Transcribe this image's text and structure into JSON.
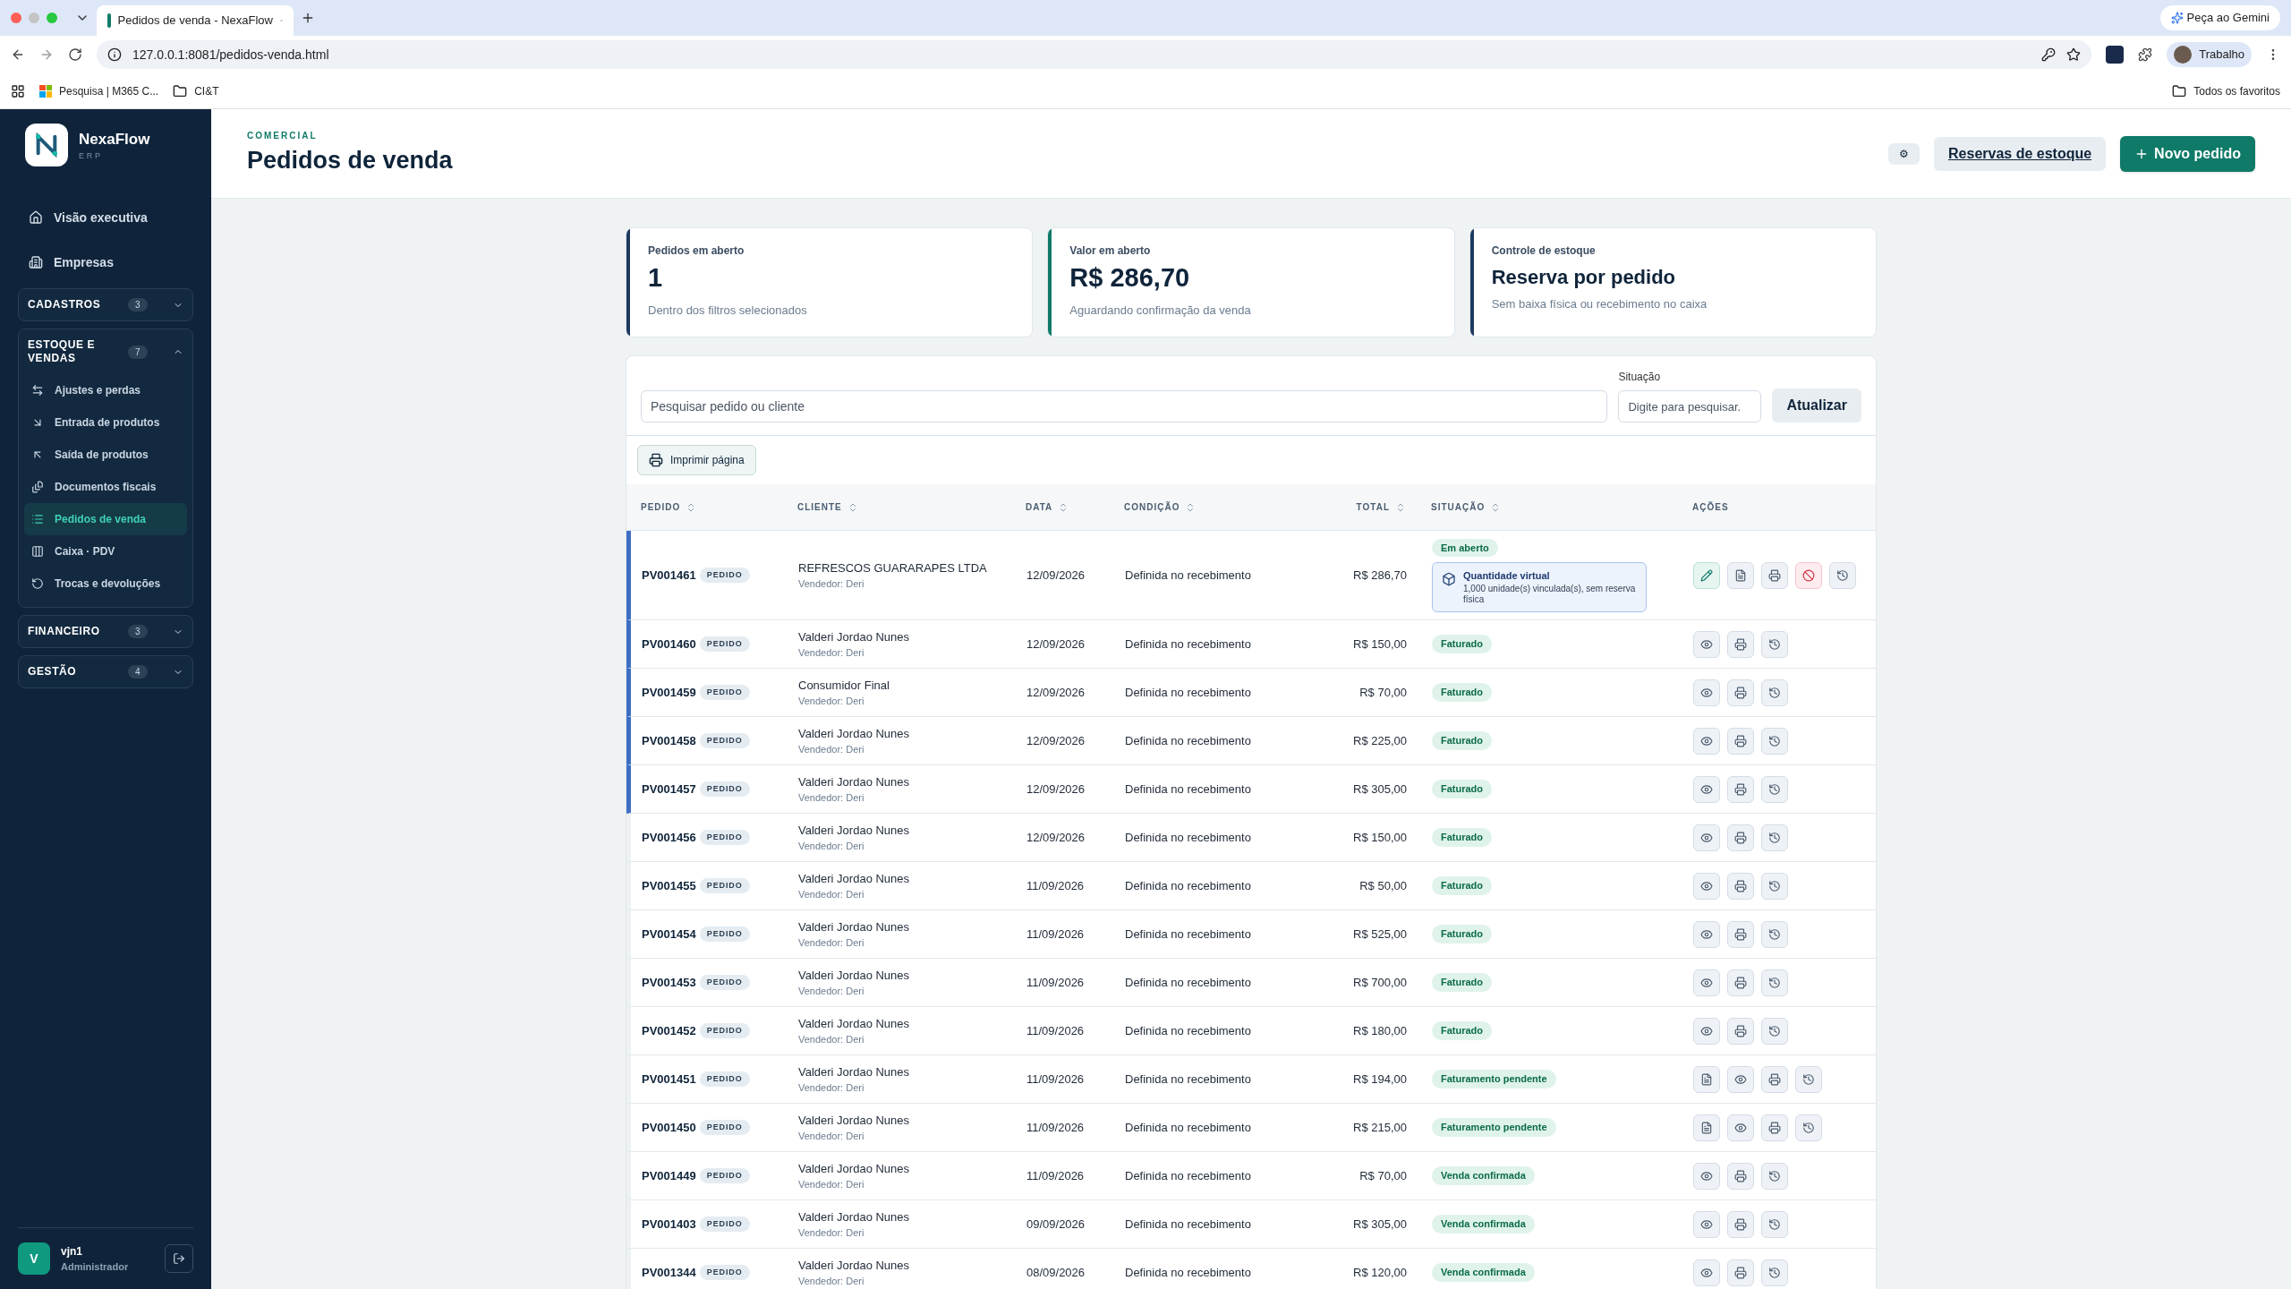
{
  "browser": {
    "tab_title": "Pedidos de venda - NexaFlow",
    "gemini": "Peça ao Gemini",
    "url": "127.0.0.1:8081/pedidos-venda.html",
    "profile": "Trabalho",
    "bookmarks": [
      "Pesquisa | M365 C...",
      "CI&T"
    ],
    "all_bookmarks": "Todos os favoritos"
  },
  "brand": {
    "name": "NexaFlow",
    "subtitle": "ERP"
  },
  "sidebar": {
    "links": [
      {
        "label": "Visão executiva",
        "selected": false
      },
      {
        "label": "Empresas",
        "selected": false
      }
    ],
    "groups": [
      {
        "label": "CADASTROS",
        "count": "3",
        "expanded": false
      },
      {
        "label": "ESTOQUE E VENDAS",
        "count": "7",
        "expanded": true,
        "items": [
          {
            "label": "Ajustes e perdas",
            "selected": false
          },
          {
            "label": "Entrada de produtos",
            "selected": false
          },
          {
            "label": "Saída de produtos",
            "selected": false
          },
          {
            "label": "Documentos fiscais",
            "selected": false
          },
          {
            "label": "Pedidos de venda",
            "selected": true
          },
          {
            "label": "Caixa · PDV",
            "selected": false
          },
          {
            "label": "Trocas e devoluções",
            "selected": false
          }
        ]
      },
      {
        "label": "FINANCEIRO",
        "count": "3",
        "expanded": false
      },
      {
        "label": "GESTÃO",
        "count": "4",
        "expanded": false
      }
    ],
    "user": {
      "initial": "V",
      "name": "vjn1",
      "role": "Administrador"
    }
  },
  "header": {
    "eyebrow": "COMERCIAL",
    "title": "Pedidos de venda",
    "settings_glyph": "⚙",
    "reservations": "Reservas de estoque",
    "new_order": "Novo pedido"
  },
  "cards": [
    {
      "label": "Pedidos em aberto",
      "value": "1",
      "note": "Dentro dos filtros selecionados",
      "color": "#1e3a5f"
    },
    {
      "label": "Valor em aberto",
      "value": "R$ 286,70",
      "note": "Aguardando confirmação da venda",
      "color": "#0f7a68"
    },
    {
      "label": "Controle de estoque",
      "value": "Reserva por pedido",
      "note": "Sem baixa física ou recebimento no caixa",
      "color": "#1e3a5f"
    }
  ],
  "filters": {
    "search_placeholder": "Pesquisar pedido ou cliente",
    "status_label": "Situação",
    "status_placeholder": "Digite para pesquisar.",
    "refresh": "Atualizar",
    "print": "Imprimir página"
  },
  "table": {
    "columns": [
      {
        "label": "PEDIDO",
        "sortable": true
      },
      {
        "label": "CLIENTE",
        "sortable": true
      },
      {
        "label": "DATA",
        "sortable": true
      },
      {
        "label": "CONDIÇÃO",
        "sortable": true
      },
      {
        "label": "TOTAL",
        "sortable": true
      },
      {
        "label": "SITUAÇÃO",
        "sortable": true
      },
      {
        "label": "AÇÕES",
        "sortable": false
      }
    ],
    "rows": [
      {
        "id": "PV001461",
        "tag": "PEDIDO",
        "client": "REFRESCOS GUARARAPES LTDA",
        "seller": "Vendedor: Deri",
        "date": "12/09/2026",
        "condition": "Definida no recebimento",
        "total": "R$ 286,70",
        "status": "Em aberto",
        "flagged": true,
        "note": {
          "title": "Quantidade virtual",
          "text": "1,000 unidade(s) vinculada(s), sem reserva física"
        },
        "actions": [
          {
            "kind": "edit"
          },
          {
            "kind": "document"
          },
          {
            "kind": "print"
          },
          {
            "kind": "cancel"
          },
          {
            "kind": "history"
          }
        ]
      },
      {
        "id": "PV001460",
        "tag": "PEDIDO",
        "client": "Valderi Jordao Nunes",
        "seller": "Vendedor: Deri",
        "date": "12/09/2026",
        "condition": "Definida no recebimento",
        "total": "R$ 150,00",
        "status": "Faturado",
        "flagged": true,
        "actions": [
          {
            "kind": "view"
          },
          {
            "kind": "print"
          },
          {
            "kind": "history"
          }
        ]
      },
      {
        "id": "PV001459",
        "tag": "PEDIDO",
        "client": "Consumidor Final",
        "seller": "Vendedor: Deri",
        "date": "12/09/2026",
        "condition": "Definida no recebimento",
        "total": "R$ 70,00",
        "status": "Faturado",
        "flagged": true,
        "actions": [
          {
            "kind": "view"
          },
          {
            "kind": "print"
          },
          {
            "kind": "history"
          }
        ]
      },
      {
        "id": "PV001458",
        "tag": "PEDIDO",
        "client": "Valderi Jordao Nunes",
        "seller": "Vendedor: Deri",
        "date": "12/09/2026",
        "condition": "Definida no recebimento",
        "total": "R$ 225,00",
        "status": "Faturado",
        "flagged": true,
        "actions": [
          {
            "kind": "view"
          },
          {
            "kind": "print"
          },
          {
            "kind": "history"
          }
        ]
      },
      {
        "id": "PV001457",
        "tag": "PEDIDO",
        "client": "Valderi Jordao Nunes",
        "seller": "Vendedor: Deri",
        "date": "12/09/2026",
        "condition": "Definida no recebimento",
        "total": "R$ 305,00",
        "status": "Faturado",
        "flagged": true,
        "actions": [
          {
            "kind": "view"
          },
          {
            "kind": "print"
          },
          {
            "kind": "history"
          }
        ]
      },
      {
        "id": "PV001456",
        "tag": "PEDIDO",
        "client": "Valderi Jordao Nunes",
        "seller": "Vendedor: Deri",
        "date": "12/09/2026",
        "condition": "Definida no recebimento",
        "total": "R$ 150,00",
        "status": "Faturado",
        "flagged": false,
        "actions": [
          {
            "kind": "view"
          },
          {
            "kind": "print"
          },
          {
            "kind": "history"
          }
        ]
      },
      {
        "id": "PV001455",
        "tag": "PEDIDO",
        "client": "Valderi Jordao Nunes",
        "seller": "Vendedor: Deri",
        "date": "11/09/2026",
        "condition": "Definida no recebimento",
        "total": "R$ 50,00",
        "status": "Faturado",
        "flagged": false,
        "actions": [
          {
            "kind": "view"
          },
          {
            "kind": "print"
          },
          {
            "kind": "history"
          }
        ]
      },
      {
        "id": "PV001454",
        "tag": "PEDIDO",
        "client": "Valderi Jordao Nunes",
        "seller": "Vendedor: Deri",
        "date": "11/09/2026",
        "condition": "Definida no recebimento",
        "total": "R$ 525,00",
        "status": "Faturado",
        "flagged": false,
        "actions": [
          {
            "kind": "view"
          },
          {
            "kind": "print"
          },
          {
            "kind": "history"
          }
        ]
      },
      {
        "id": "PV001453",
        "tag": "PEDIDO",
        "client": "Valderi Jordao Nunes",
        "seller": "Vendedor: Deri",
        "date": "11/09/2026",
        "condition": "Definida no recebimento",
        "total": "R$ 700,00",
        "status": "Faturado",
        "flagged": false,
        "actions": [
          {
            "kind": "view"
          },
          {
            "kind": "print"
          },
          {
            "kind": "history"
          }
        ]
      },
      {
        "id": "PV001452",
        "tag": "PEDIDO",
        "client": "Valderi Jordao Nunes",
        "seller": "Vendedor: Deri",
        "date": "11/09/2026",
        "condition": "Definida no recebimento",
        "total": "R$ 180,00",
        "status": "Faturado",
        "flagged": false,
        "actions": [
          {
            "kind": "view"
          },
          {
            "kind": "print"
          },
          {
            "kind": "history"
          }
        ]
      },
      {
        "id": "PV001451",
        "tag": "PEDIDO",
        "client": "Valderi Jordao Nunes",
        "seller": "Vendedor: Deri",
        "date": "11/09/2026",
        "condition": "Definida no recebimento",
        "total": "R$ 194,00",
        "status": "Faturamento pendente",
        "flagged": false,
        "actions": [
          {
            "kind": "document"
          },
          {
            "kind": "view"
          },
          {
            "kind": "print"
          },
          {
            "kind": "history"
          }
        ]
      },
      {
        "id": "PV001450",
        "tag": "PEDIDO",
        "client": "Valderi Jordao Nunes",
        "seller": "Vendedor: Deri",
        "date": "11/09/2026",
        "condition": "Definida no recebimento",
        "total": "R$ 215,00",
        "status": "Faturamento pendente",
        "flagged": false,
        "actions": [
          {
            "kind": "document"
          },
          {
            "kind": "view"
          },
          {
            "kind": "print"
          },
          {
            "kind": "history"
          }
        ]
      },
      {
        "id": "PV001449",
        "tag": "PEDIDO",
        "client": "Valderi Jordao Nunes",
        "seller": "Vendedor: Deri",
        "date": "11/09/2026",
        "condition": "Definida no recebimento",
        "total": "R$ 70,00",
        "status": "Venda confirmada",
        "flagged": false,
        "actions": [
          {
            "kind": "view"
          },
          {
            "kind": "print"
          },
          {
            "kind": "history"
          }
        ]
      },
      {
        "id": "PV001403",
        "tag": "PEDIDO",
        "client": "Valderi Jordao Nunes",
        "seller": "Vendedor: Deri",
        "date": "09/09/2026",
        "condition": "Definida no recebimento",
        "total": "R$ 305,00",
        "status": "Venda confirmada",
        "flagged": false,
        "actions": [
          {
            "kind": "view"
          },
          {
            "kind": "print"
          },
          {
            "kind": "history"
          }
        ]
      },
      {
        "id": "PV001344",
        "tag": "PEDIDO",
        "client": "Valderi Jordao Nunes",
        "seller": "Vendedor: Deri",
        "date": "08/09/2026",
        "condition": "Definida no recebimento",
        "total": "R$ 120,00",
        "status": "Venda confirmada",
        "flagged": false,
        "actions": [
          {
            "kind": "view"
          },
          {
            "kind": "print"
          },
          {
            "kind": "history"
          }
        ]
      }
    ]
  }
}
